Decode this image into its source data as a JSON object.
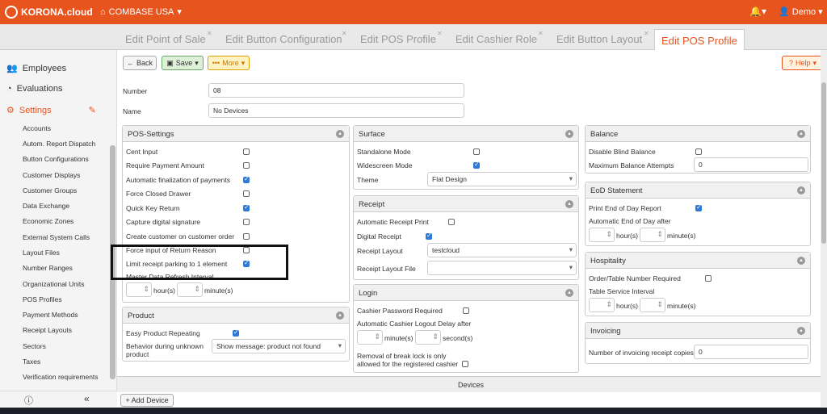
{
  "header": {
    "brand": "KORONA.cloud",
    "org": "COMBASE USA",
    "user": "Demo"
  },
  "tabs": [
    "Edit Point of Sale",
    "Edit Button Configuration",
    "Edit POS Profile",
    "Edit Cashier Role",
    "Edit Button Layout",
    "Edit POS Profile"
  ],
  "sidebar": {
    "main": [
      "Employees",
      "Evaluations",
      "Settings"
    ],
    "sub": [
      "Accounts",
      "Autom. Report Dispatch",
      "Button Configurations",
      "Customer Displays",
      "Customer Groups",
      "Data Exchange",
      "Economic Zones",
      "External System Calls",
      "Layout Files",
      "Number Ranges",
      "Organizational Units",
      "POS Profiles",
      "Payment Methods",
      "Receipt Layouts",
      "Sectors",
      "Taxes",
      "Verification requirements"
    ]
  },
  "toolbar": {
    "back": "Back",
    "save": "Save",
    "more": "More",
    "help": "Help"
  },
  "form": {
    "number_label": "Number",
    "number": "08",
    "name_label": "Name",
    "name": "No Devices"
  },
  "pos_settings": {
    "title": "POS-Settings",
    "items": [
      "Cent Input",
      "Require Payment Amount",
      "Automatic finalization of payments",
      "Force Closed Drawer",
      "Quick Key Return",
      "Capture digital signature",
      "Create customer on customer order",
      "Force input of Return Reason",
      "Limit receipt parking to 1 element"
    ],
    "refresh_label": "Master Data Refresh Interval",
    "hours": "hour(s)",
    "minutes": "minute(s)"
  },
  "product": {
    "title": "Product",
    "easy": "Easy Product Repeating",
    "behavior": "Behavior during unknown product",
    "behavior_value": "Show message: product not found"
  },
  "surface": {
    "title": "Surface",
    "standalone": "Standalone Mode",
    "widescreen": "Widescreen Mode",
    "theme_label": "Theme",
    "theme": "Flat Design"
  },
  "receipt": {
    "title": "Receipt",
    "auto_print": "Automatic Receipt Print",
    "digital": "Digital Receipt",
    "layout_label": "Receipt Layout",
    "layout": "testcloud",
    "file_label": "Receipt Layout File"
  },
  "login": {
    "title": "Login",
    "pw": "Cashier Password Required",
    "delay": "Automatic Cashier Logout Delay after",
    "minutes": "minute(s)",
    "seconds": "second(s)",
    "breaklock": "Removal of break lock is only allowed for the registered cashier"
  },
  "balance": {
    "title": "Balance",
    "blind": "Disable Blind Balance",
    "attempts": "Maximum Balance Attempts",
    "attempts_value": "0"
  },
  "eod": {
    "title": "EoD Statement",
    "print": "Print End of Day Report",
    "auto": "Automatic End of Day after",
    "hours": "hour(s)",
    "minutes": "minute(s)"
  },
  "hospitality": {
    "title": "Hospitality",
    "order": "Order/Table Number Required",
    "interval": "Table Service Interval",
    "hours": "hour(s)",
    "minutes": "minute(s)"
  },
  "invoicing": {
    "title": "Invoicing",
    "copies": "Number of invoicing receipt copies",
    "copies_value": "0"
  },
  "devices": {
    "title": "Devices",
    "add": "+ Add Device"
  }
}
